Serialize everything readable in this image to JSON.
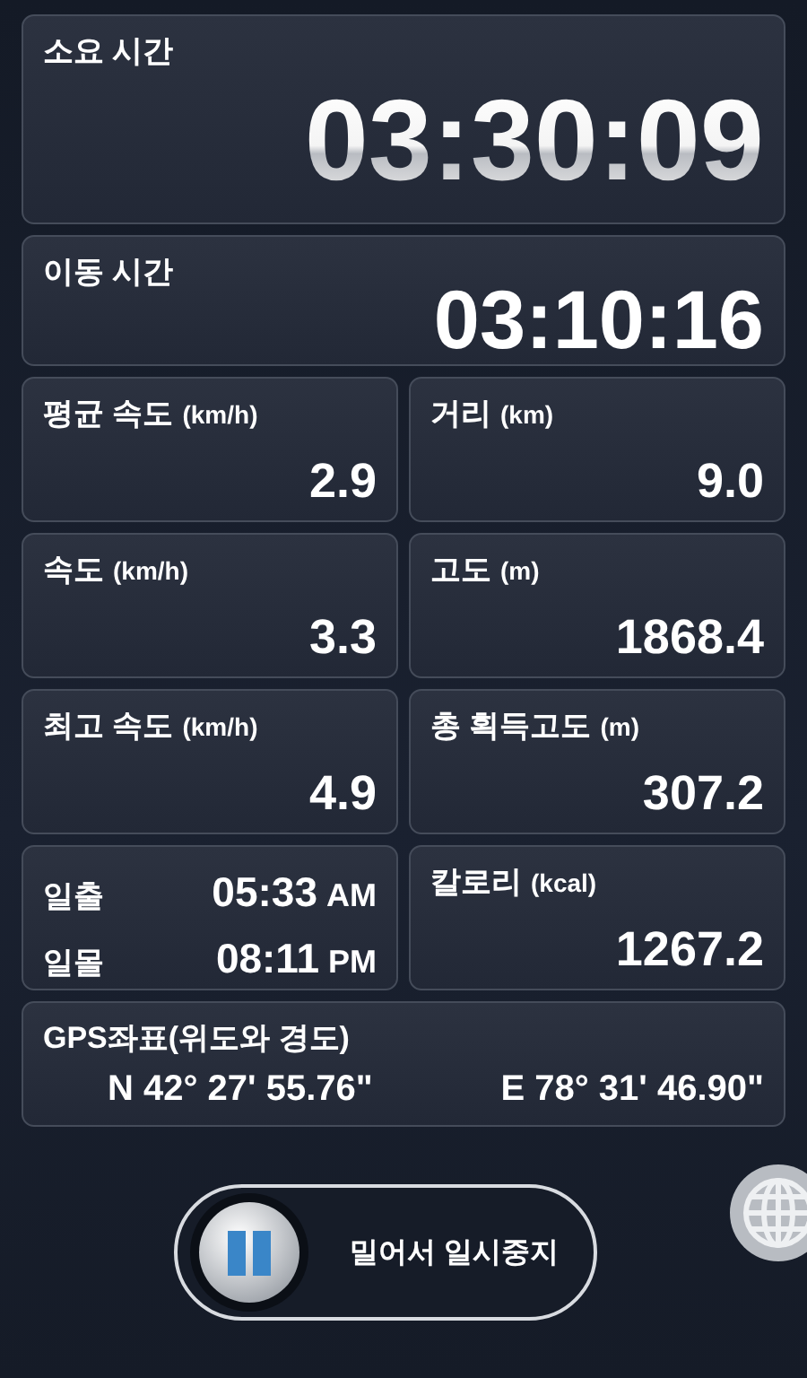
{
  "elapsed_time": {
    "label": "소요 시간",
    "value": "03:30:09"
  },
  "moving_time": {
    "label": "이동 시간",
    "value": "03:10:16"
  },
  "stats": [
    {
      "label": "평균 속도",
      "unit": "(km/h)",
      "value": "2.9"
    },
    {
      "label": "거리",
      "unit": "(km)",
      "value": "9.0"
    },
    {
      "label": "속도",
      "unit": "(km/h)",
      "value": "3.3"
    },
    {
      "label": "고도",
      "unit": "(m)",
      "value": "1868.4"
    },
    {
      "label": "최고 속도",
      "unit": "(km/h)",
      "value": "4.9"
    },
    {
      "label": "총 획득고도",
      "unit": "(m)",
      "value": "307.2"
    }
  ],
  "sun": [
    {
      "label": "일출",
      "time": "05:33",
      "period": "AM"
    },
    {
      "label": "일몰",
      "time": "08:11",
      "period": "PM"
    }
  ],
  "calories": {
    "label": "칼로리",
    "unit": "(kcal)",
    "value": "1267.2"
  },
  "gps": {
    "label": "GPS좌표(위도와 경도)",
    "latitude": "N 42° 27' 55.76\"",
    "longitude": "E 78° 31' 46.90\""
  },
  "pause_slider": {
    "label": "밀어서 일시중지",
    "level": 0
  }
}
